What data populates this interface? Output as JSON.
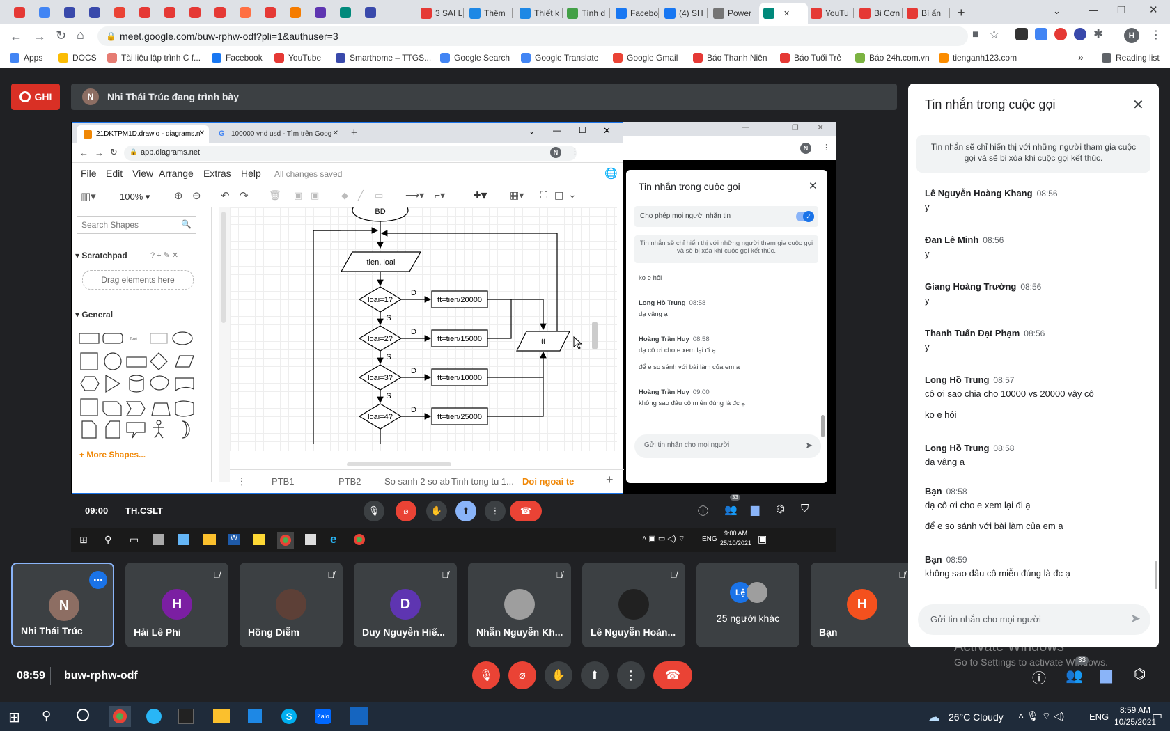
{
  "browser": {
    "tabs": [
      "3 SAI L",
      "Thêm",
      "Thiết k",
      "Tính d",
      "Facebo",
      "(4) SH",
      "Power",
      "",
      "YouTu",
      "Bị Cơn",
      "Bí ẩn"
    ],
    "url": "meet.google.com/buw-rphw-odf?pli=1&authuser=3",
    "bookmarks": [
      "Apps",
      "DOCS",
      "Tài liệu lập trình C f...",
      "Facebook",
      "YouTube",
      "Smarthome – TTGS...",
      "Google Search",
      "Google Translate",
      "Google Gmail",
      "Báo Thanh Niên",
      "Báo Tuổi Trẻ",
      "Báo 24h.com.vn",
      "tienganh123.com",
      "Reading list"
    ]
  },
  "meet": {
    "record_label": "GHI",
    "presenter_initial": "N",
    "presenting_text": "Nhi Thái Trúc đang trình bày",
    "time": "08:59",
    "meeting_code": "buw-rphw-odf",
    "participants_count": "33",
    "watermark_line1": "Activate Windows",
    "watermark_line2": "Go to Settings to activate Windows."
  },
  "drawio": {
    "tab1": "21DKTPM1D.drawio - diagrams.n",
    "tab2": "100000 vnd usd - Tìm trên Goog",
    "address": "app.diagrams.net",
    "menu": [
      "File",
      "Edit",
      "View",
      "Arrange",
      "Extras",
      "Help"
    ],
    "saved_status": "All changes saved",
    "zoom": "100%",
    "search_placeholder": "Search Shapes",
    "scratchpad": "Scratchpad",
    "drag_here": "Drag elements here",
    "general": "General",
    "more_shapes": "+ More Shapes...",
    "pages": [
      "PTB1",
      "PTB2",
      "So sanh 2 so ab",
      "Tinh tong tu 1...",
      "Doi ngoai te"
    ],
    "flow": {
      "start": "BD",
      "input": "tien, loai",
      "cond1": "loai=1?",
      "cond2": "loai=2?",
      "cond3": "loai=3?",
      "cond4": "loai=4?",
      "assign1": "tt=tien/20000",
      "assign2": "tt=tien/15000",
      "assign3": "tt=tien/10000",
      "assign4": "tt=tien/25000",
      "output": "tt",
      "yes": "D",
      "no": "S"
    }
  },
  "shared_meet": {
    "time": "09:00",
    "code": "TH.CSLT",
    "count": "33",
    "chat_title": "Tin nhắn trong cuộc gọi",
    "allow_label": "Cho phép mọi người nhắn tin",
    "notice": "Tin nhắn sẽ chỉ hiển thị với những người tham gia cuộc gọi và sẽ bị xóa khi cuộc gọi kết thúc.",
    "messages": [
      {
        "name": "",
        "time": "",
        "lines": [
          "ko e hỏi"
        ]
      },
      {
        "name": "Long Hồ Trung",
        "time": "08:58",
        "lines": [
          "dạ vâng ạ"
        ]
      },
      {
        "name": "Hoàng Trần Huy",
        "time": "08:58",
        "lines": [
          "dạ cô ơi cho e xem lại đi ạ",
          "để e so sánh với bài làm của em ạ"
        ]
      },
      {
        "name": "Hoàng Trần Huy",
        "time": "09:00",
        "lines": [
          "không sao đâu cô miễn đúng là đc ạ"
        ]
      }
    ],
    "input_placeholder": "Gửi tin nhắn cho mọi người",
    "taskbar_time": "9:00 AM",
    "taskbar_date": "25/10/2021",
    "taskbar_lang": "ENG"
  },
  "tiles": [
    {
      "name": "Nhi Thái Trúc",
      "initial": "N",
      "color": "#8d6e63"
    },
    {
      "name": "Hải Lê Phi",
      "initial": "H",
      "color": "#7b1fa2"
    },
    {
      "name": "Hồng Diễm",
      "initial": "",
      "color": "#5d4037"
    },
    {
      "name": "Duy Nguyễn Hiế...",
      "initial": "D",
      "color": "#5e35b1"
    },
    {
      "name": "Nhẫn Nguyễn Kh...",
      "initial": "",
      "color": "#9e9e9e"
    },
    {
      "name": "Lê Nguyễn Hoàn...",
      "initial": "",
      "color": "#212121"
    },
    {
      "name": "25 người khác",
      "initial": "Lệ",
      "color": "#1a73e8"
    },
    {
      "name": "Bạn",
      "initial": "H",
      "color": "#f4511e"
    }
  ],
  "chat": {
    "title": "Tin nhắn trong cuộc gọi",
    "notice": "Tin nhắn sẽ chỉ hiển thị với những người tham gia cuộc gọi và sẽ bị xóa khi cuộc gọi kết thúc.",
    "messages": [
      {
        "name": "Lê Nguyễn Hoàng Khang",
        "time": "08:56",
        "lines": [
          "y"
        ]
      },
      {
        "name": "Đan Lê Minh",
        "time": "08:56",
        "lines": [
          "y"
        ]
      },
      {
        "name": "Giang Hoàng Trường",
        "time": "08:56",
        "lines": [
          "y"
        ]
      },
      {
        "name": "Thanh Tuấn Đạt Phạm",
        "time": "08:56",
        "lines": [
          "y"
        ]
      },
      {
        "name": "Long Hồ Trung",
        "time": "08:57",
        "lines": [
          "cô ơi sao chia cho 10000 vs 20000 vậy cô",
          "ko e hỏi"
        ]
      },
      {
        "name": "Long Hồ Trung",
        "time": "08:58",
        "lines": [
          "dạ vâng ạ"
        ]
      },
      {
        "name": "Bạn",
        "time": "08:58",
        "lines": [
          "dạ cô ơi cho e xem lại đi ạ",
          "để e so sánh với bài làm của em ạ"
        ]
      },
      {
        "name": "Bạn",
        "time": "08:59",
        "lines": [
          "không sao đâu cô miễn đúng là đc ạ"
        ]
      }
    ],
    "input_placeholder": "Gửi tin nhắn cho mọi người"
  },
  "taskbar": {
    "weather": "26°C  Cloudy",
    "lang": "ENG",
    "time": "8:59 AM",
    "date": "10/25/2021"
  }
}
